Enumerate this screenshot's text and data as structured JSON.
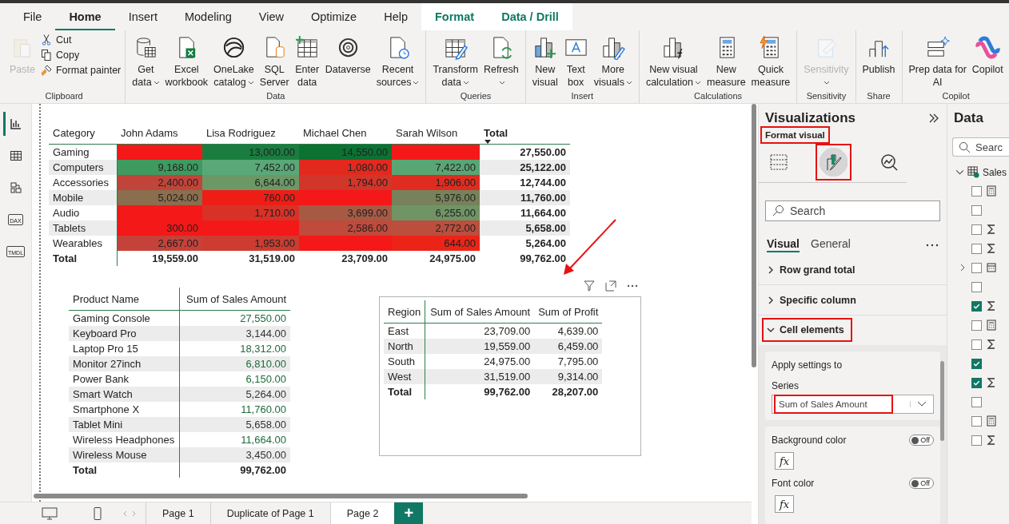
{
  "ribbon_tabs": [
    {
      "label": "File",
      "selected": false,
      "contextual": false
    },
    {
      "label": "Home",
      "selected": true,
      "contextual": false
    },
    {
      "label": "Insert",
      "selected": false,
      "contextual": false
    },
    {
      "label": "Modeling",
      "selected": false,
      "contextual": false
    },
    {
      "label": "View",
      "selected": false,
      "contextual": false
    },
    {
      "label": "Optimize",
      "selected": false,
      "contextual": false
    },
    {
      "label": "Help",
      "selected": false,
      "contextual": false
    },
    {
      "label": "Format",
      "selected": false,
      "contextual": true
    },
    {
      "label": "Data / Drill",
      "selected": false,
      "contextual": true
    }
  ],
  "ribbon_groups": [
    {
      "name": "Clipboard",
      "buttons": [
        {
          "kind": "paste",
          "label": "Paste",
          "small": false,
          "dropdown": false,
          "disabled": true
        },
        {
          "kind": "cut",
          "label": "Cut",
          "small": true,
          "dropdown": false,
          "disabled": false
        },
        {
          "kind": "copy",
          "label": "Copy",
          "small": true,
          "dropdown": false,
          "disabled": false
        },
        {
          "kind": "painter",
          "label": "Format painter",
          "small": true,
          "dropdown": false,
          "disabled": false
        }
      ]
    },
    {
      "name": "Data",
      "buttons": [
        {
          "kind": "getdata",
          "label": "Get\ndata",
          "small": false,
          "dropdown": true,
          "disabled": false
        },
        {
          "kind": "excel",
          "label": "Excel\nworkbook",
          "small": false,
          "dropdown": false,
          "disabled": false
        },
        {
          "kind": "onelake",
          "label": "OneLake\ncatalog",
          "small": false,
          "dropdown": true,
          "disabled": false
        },
        {
          "kind": "sql",
          "label": "SQL\nServer",
          "small": false,
          "dropdown": false,
          "disabled": false
        },
        {
          "kind": "enter",
          "label": "Enter\ndata",
          "small": false,
          "dropdown": false,
          "disabled": false
        },
        {
          "kind": "dataverse",
          "label": "Dataverse",
          "small": false,
          "dropdown": false,
          "disabled": false
        },
        {
          "kind": "recent",
          "label": "Recent\nsources",
          "small": false,
          "dropdown": true,
          "disabled": false
        }
      ]
    },
    {
      "name": "Queries",
      "buttons": [
        {
          "kind": "transform",
          "label": "Transform\ndata",
          "small": false,
          "dropdown": true,
          "disabled": false
        },
        {
          "kind": "refresh",
          "label": "Refresh",
          "small": false,
          "dropdown": true,
          "disabled": false
        }
      ]
    },
    {
      "name": "Insert",
      "buttons": [
        {
          "kind": "newvisual",
          "label": "New\nvisual",
          "small": false,
          "dropdown": false,
          "disabled": false
        },
        {
          "kind": "textbox",
          "label": "Text\nbox",
          "small": false,
          "dropdown": false,
          "disabled": false
        },
        {
          "kind": "morevisuals",
          "label": "More\nvisuals",
          "small": false,
          "dropdown": true,
          "disabled": false
        }
      ]
    },
    {
      "name": "Calculations",
      "buttons": [
        {
          "kind": "visualcalc",
          "label": "New visual\ncalculation",
          "small": false,
          "dropdown": true,
          "disabled": false
        },
        {
          "kind": "measure",
          "label": "New\nmeasure",
          "small": false,
          "dropdown": false,
          "disabled": false
        },
        {
          "kind": "quick",
          "label": "Quick\nmeasure",
          "small": false,
          "dropdown": false,
          "disabled": false
        }
      ]
    },
    {
      "name": "Sensitivity",
      "buttons": [
        {
          "kind": "sensitivity",
          "label": "Sensitivity",
          "small": false,
          "dropdown": true,
          "disabled": true
        }
      ]
    },
    {
      "name": "Share",
      "buttons": [
        {
          "kind": "publish",
          "label": "Publish",
          "small": false,
          "dropdown": false,
          "disabled": false
        }
      ]
    },
    {
      "name": "Copilot",
      "buttons": [
        {
          "kind": "prep",
          "label": "Prep data for\nAI",
          "small": false,
          "dropdown": false,
          "disabled": false
        },
        {
          "kind": "copilot",
          "label": "Copilot",
          "small": false,
          "dropdown": false,
          "disabled": false
        }
      ]
    }
  ],
  "view_rail": [
    {
      "kind": "report",
      "selected": true
    },
    {
      "kind": "table",
      "selected": false
    },
    {
      "kind": "model",
      "selected": false
    },
    {
      "kind": "dax",
      "label": "DAX",
      "selected": false
    },
    {
      "kind": "tmdl",
      "label": "TMDL",
      "selected": false
    }
  ],
  "matrix": {
    "columns": [
      {
        "label": "Category",
        "sorted": false
      },
      {
        "label": "John Adams",
        "sorted": false
      },
      {
        "label": "Lisa Rodriguez",
        "sorted": false
      },
      {
        "label": "Michael Chen",
        "sorted": false
      },
      {
        "label": "Sarah Wilson",
        "sorted": false
      },
      {
        "label": "Total",
        "sorted": true
      }
    ],
    "rows": [
      {
        "cells": [
          {
            "kind": "label",
            "value": "Gaming"
          },
          {
            "kind": "heat",
            "color": "#f41818"
          },
          {
            "kind": "heat",
            "value": "13,000.00",
            "color": "#1a7d3f"
          },
          {
            "kind": "heat",
            "value": "14,550.00",
            "color": "#0c7232"
          },
          {
            "kind": "heat",
            "color": "#f41818"
          },
          {
            "kind": "total",
            "value": "27,550.00"
          }
        ]
      },
      {
        "cells": [
          {
            "kind": "label",
            "value": "Computers"
          },
          {
            "kind": "heat",
            "value": "9,168.00",
            "color": "#3f9a60"
          },
          {
            "kind": "heat",
            "value": "7,452.00",
            "color": "#5aa877"
          },
          {
            "kind": "heat",
            "value": "1,080.00",
            "color": "#e3291e"
          },
          {
            "kind": "heat",
            "value": "7,422.00",
            "color": "#58a674"
          },
          {
            "kind": "total",
            "value": "25,122.00"
          }
        ]
      },
      {
        "cells": [
          {
            "kind": "label",
            "value": "Accessories"
          },
          {
            "kind": "heat",
            "value": "2,400.00",
            "color": "#c0443a"
          },
          {
            "kind": "heat",
            "value": "6,644.00",
            "color": "#6c9866"
          },
          {
            "kind": "heat",
            "value": "1,794.00",
            "color": "#d2352a"
          },
          {
            "kind": "heat",
            "value": "1,906.00",
            "color": "#e02c20"
          },
          {
            "kind": "total",
            "value": "12,744.00"
          }
        ]
      },
      {
        "cells": [
          {
            "kind": "label",
            "value": "Mobile"
          },
          {
            "kind": "heat",
            "value": "5,024.00",
            "color": "#8a6e4e"
          },
          {
            "kind": "heat",
            "value": "760.00",
            "color": "#ee1e16"
          },
          {
            "kind": "heat",
            "color": "#f41818"
          },
          {
            "kind": "heat",
            "value": "5,976.00",
            "color": "#77825a"
          },
          {
            "kind": "total",
            "value": "11,760.00"
          }
        ]
      },
      {
        "cells": [
          {
            "kind": "label",
            "value": "Audio"
          },
          {
            "kind": "heat",
            "color": "#f41818"
          },
          {
            "kind": "heat",
            "value": "1,710.00",
            "color": "#d83228"
          },
          {
            "kind": "heat",
            "value": "3,699.00",
            "color": "#a65a44"
          },
          {
            "kind": "heat",
            "value": "6,255.00",
            "color": "#709466"
          },
          {
            "kind": "total",
            "value": "11,664.00"
          }
        ]
      },
      {
        "cells": [
          {
            "kind": "label",
            "value": "Tablets"
          },
          {
            "kind": "heat",
            "value": "300.00",
            "color": "#f41818"
          },
          {
            "kind": "heat",
            "color": "#f41818"
          },
          {
            "kind": "heat",
            "value": "2,586.00",
            "color": "#c04a3c"
          },
          {
            "kind": "heat",
            "value": "2,772.00",
            "color": "#bc4e3e"
          },
          {
            "kind": "total",
            "value": "5,658.00"
          }
        ]
      },
      {
        "cells": [
          {
            "kind": "label",
            "value": "Wearables"
          },
          {
            "kind": "heat",
            "value": "2,667.00",
            "color": "#c4423a"
          },
          {
            "kind": "heat",
            "value": "1,953.00",
            "color": "#cc3c30"
          },
          {
            "kind": "heat",
            "color": "#f41818"
          },
          {
            "kind": "heat",
            "value": "644.00",
            "color": "#ec2418"
          },
          {
            "kind": "total",
            "value": "5,264.00"
          }
        ]
      }
    ],
    "total_row": {
      "cells": [
        "Total",
        "19,559.00",
        "31,519.00",
        "23,709.00",
        "24,975.00",
        "99,762.00"
      ]
    }
  },
  "product_table": {
    "columns": [
      "Product Name",
      "Sum of Sales Amount"
    ],
    "rows": [
      {
        "name": "Gaming Console",
        "value": "27,550.00",
        "color": "#1e6b3c"
      },
      {
        "name": "Keyboard Pro",
        "value": "3,144.00",
        "color": "#333333"
      },
      {
        "name": "Laptop Pro 15",
        "value": "18,312.00",
        "color": "#1e6b3c"
      },
      {
        "name": "Monitor 27inch",
        "value": "6,810.00",
        "color": "#1e6b3c"
      },
      {
        "name": "Power Bank",
        "value": "6,150.00",
        "color": "#1e6b3c"
      },
      {
        "name": "Smart Watch",
        "value": "5,264.00",
        "color": "#333333"
      },
      {
        "name": "Smartphone X",
        "value": "11,760.00",
        "color": "#1e6b3c"
      },
      {
        "name": "Tablet Mini",
        "value": "5,658.00",
        "color": "#333333"
      },
      {
        "name": "Wireless Headphones",
        "value": "11,664.00",
        "color": "#1e6b3c"
      },
      {
        "name": "Wireless Mouse",
        "value": "3,450.00",
        "color": "#333333"
      }
    ],
    "total": {
      "label": "Total",
      "value": "99,762.00"
    }
  },
  "region_table": {
    "selected": true,
    "columns": [
      "Region",
      "Sum of Sales Amount",
      "Sum of Profit"
    ],
    "rows": [
      {
        "region": "East",
        "sales": "23,709.00",
        "profit": "4,639.00"
      },
      {
        "region": "North",
        "sales": "19,559.00",
        "profit": "6,459.00"
      },
      {
        "region": "South",
        "sales": "24,975.00",
        "profit": "7,795.00"
      },
      {
        "region": "West",
        "sales": "31,519.00",
        "profit": "9,314.00"
      }
    ],
    "total": {
      "label": "Total",
      "sales": "99,762.00",
      "profit": "28,207.00"
    }
  },
  "page_tabs": [
    {
      "label": "Page 1",
      "selected": false
    },
    {
      "label": "Duplicate of Page 1",
      "selected": false
    },
    {
      "label": "Page 2",
      "selected": true
    }
  ],
  "add_page": "+",
  "visualizations": {
    "title": "Visualizations",
    "subtitle": "Format visual",
    "subtitle_highlighted": true,
    "modes": [
      {
        "kind": "build",
        "selected": false,
        "highlighted": false
      },
      {
        "kind": "format",
        "selected": true,
        "highlighted": true
      },
      {
        "kind": "analytics",
        "selected": false,
        "highlighted": false
      }
    ],
    "search": {
      "placeholder": "Search"
    },
    "tabs": [
      {
        "label": "Visual",
        "selected": true
      },
      {
        "label": "General",
        "selected": false
      }
    ],
    "sections": [
      {
        "label": "Row grand total",
        "expanded": false,
        "highlighted": false
      },
      {
        "label": "Specific column",
        "expanded": false,
        "highlighted": false
      },
      {
        "label": "Cell elements",
        "expanded": true,
        "highlighted": true
      }
    ],
    "apply_label": "Apply settings to",
    "series_label": "Series",
    "series_value": "Sum of Sales Amount",
    "series_highlighted": true,
    "settings": [
      {
        "label": "Background color",
        "toggle": "Off",
        "on": false,
        "button": "fx"
      },
      {
        "label": "Font color",
        "toggle": "Off",
        "on": false,
        "button": "fx"
      }
    ]
  },
  "data_pane": {
    "title": "Data",
    "search": {
      "placeholder": "Searc"
    },
    "table": {
      "name": "Sales",
      "expanded": true
    },
    "fields": [
      {
        "kind": "measure",
        "checked": false,
        "expandable": false
      },
      {
        "kind": "text",
        "checked": false,
        "expandable": false
      },
      {
        "kind": "sum",
        "checked": false,
        "expandable": false
      },
      {
        "kind": "sum",
        "checked": false,
        "expandable": false
      },
      {
        "kind": "date",
        "checked": false,
        "expandable": true
      },
      {
        "kind": "text",
        "checked": false,
        "expandable": false
      },
      {
        "kind": "sum",
        "checked": true,
        "expandable": false
      },
      {
        "kind": "measure",
        "checked": false,
        "expandable": false
      },
      {
        "kind": "sum",
        "checked": false,
        "expandable": false
      },
      {
        "kind": "text",
        "checked": true,
        "expandable": false
      },
      {
        "kind": "sum",
        "checked": true,
        "expandable": false
      },
      {
        "kind": "text",
        "checked": false,
        "expandable": false
      },
      {
        "kind": "measure",
        "checked": false,
        "expandable": false
      },
      {
        "kind": "sum",
        "checked": false,
        "expandable": false
      }
    ]
  }
}
